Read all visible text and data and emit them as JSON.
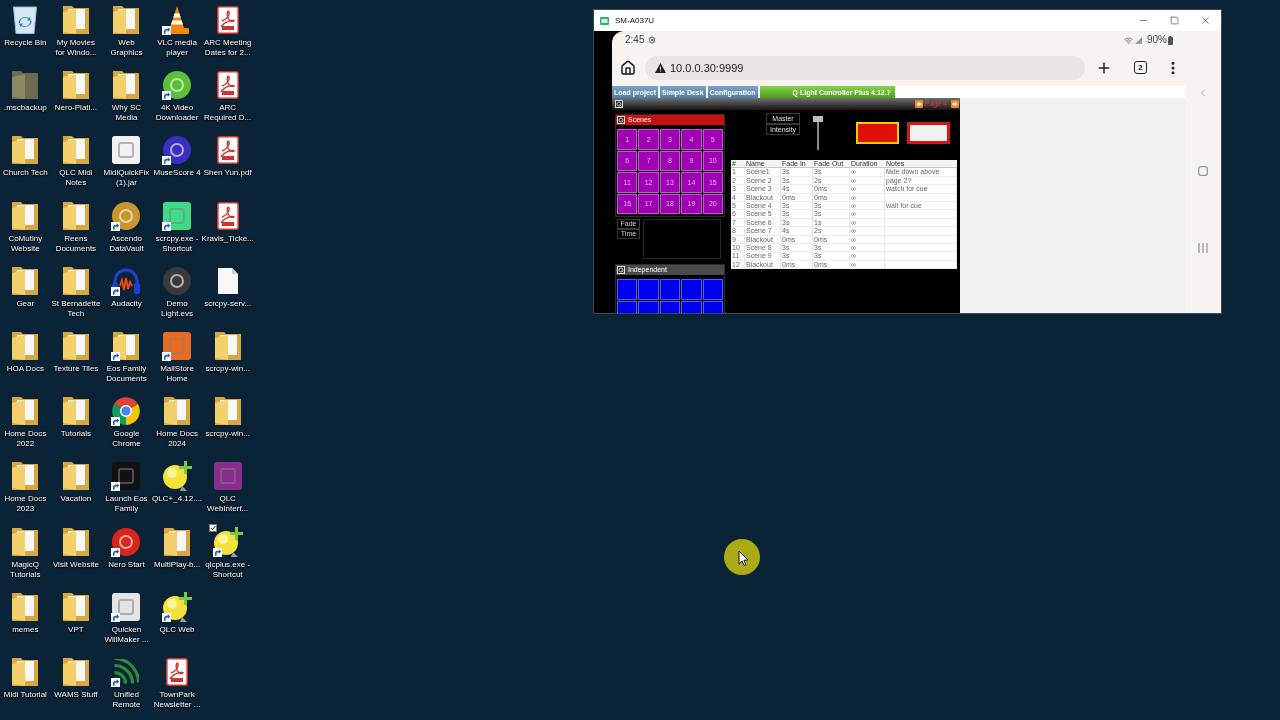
{
  "desktop": {
    "icons": [
      {
        "label": "Recycle Bin",
        "kind": "recycle-bin",
        "shortcut": false,
        "checked": false
      },
      {
        "label": ".mscbackup",
        "kind": "hidden-folder",
        "shortcut": false,
        "checked": false
      },
      {
        "label": "Church Tech",
        "kind": "folder",
        "shortcut": false,
        "checked": false
      },
      {
        "label": "CoMutiny Website",
        "kind": "folder",
        "shortcut": false,
        "checked": false
      },
      {
        "label": "Gear",
        "kind": "folder",
        "shortcut": false,
        "checked": false
      },
      {
        "label": "HOA Docs",
        "kind": "folder",
        "shortcut": false,
        "checked": false
      },
      {
        "label": "Home Docs 2022",
        "kind": "folder",
        "shortcut": false,
        "checked": false
      },
      {
        "label": "Home Docs 2023",
        "kind": "folder",
        "shortcut": false,
        "checked": false
      },
      {
        "label": "MagicQ Tutorials",
        "kind": "folder",
        "shortcut": false,
        "checked": false
      },
      {
        "label": "memes",
        "kind": "folder",
        "shortcut": false,
        "checked": false
      },
      {
        "label": "Midi Tutorial",
        "kind": "folder",
        "shortcut": false,
        "checked": false
      },
      {
        "label": "My Movies for Windo...",
        "kind": "folder",
        "shortcut": false,
        "checked": false
      },
      {
        "label": "Nero-Plati...",
        "kind": "folder",
        "shortcut": false,
        "checked": false
      },
      {
        "label": "QLC Midi Notes",
        "kind": "folder",
        "shortcut": false,
        "checked": false
      },
      {
        "label": "Reens Documents",
        "kind": "folder",
        "shortcut": false,
        "checked": false
      },
      {
        "label": "St Bernadette Tech",
        "kind": "folder",
        "shortcut": false,
        "checked": false
      },
      {
        "label": "Texture Tiles",
        "kind": "folder",
        "shortcut": false,
        "checked": false
      },
      {
        "label": "Tutorials",
        "kind": "folder",
        "shortcut": false,
        "checked": false
      },
      {
        "label": "Vacation",
        "kind": "folder",
        "shortcut": false,
        "checked": false
      },
      {
        "label": "Visit Website",
        "kind": "folder",
        "shortcut": false,
        "checked": false
      },
      {
        "label": "VPT",
        "kind": "folder",
        "shortcut": false,
        "checked": false
      },
      {
        "label": "WAMS Stuff",
        "kind": "folder",
        "shortcut": false,
        "checked": false
      },
      {
        "label": "Web Graphics",
        "kind": "folder",
        "shortcut": false,
        "checked": false
      },
      {
        "label": "Why SC Media",
        "kind": "folder",
        "shortcut": false,
        "checked": false
      },
      {
        "label": "MidiQuickFix (1).jar",
        "kind": "tile",
        "color": "#f2f2f2",
        "shortcut": false,
        "checked": false
      },
      {
        "label": "Ascendo DataVault",
        "kind": "disc",
        "color": "#c8962e",
        "shortcut": true,
        "checked": false
      },
      {
        "label": "Audacity",
        "kind": "headphones",
        "shortcut": true,
        "checked": false
      },
      {
        "label": "Eos Family Documents",
        "kind": "folder",
        "shortcut": true,
        "checked": false
      },
      {
        "label": "Google Chrome",
        "kind": "pinwheel",
        "shortcut": true,
        "checked": false
      },
      {
        "label": "Launch Eos Family",
        "kind": "tile",
        "color": "#111111",
        "shortcut": true,
        "checked": false
      },
      {
        "label": "Nero Start",
        "kind": "disc",
        "color": "#d8261c",
        "shortcut": true,
        "checked": false
      },
      {
        "label": "Quicken WillMaker ...",
        "kind": "tile",
        "color": "#e4e4e4",
        "shortcut": true,
        "checked": false
      },
      {
        "label": "Unified Remote",
        "kind": "waves",
        "shortcut": true,
        "checked": false
      },
      {
        "label": "VLC media player",
        "kind": "cone",
        "shortcut": true,
        "checked": false
      },
      {
        "label": "4K Video Downloader",
        "kind": "disc",
        "color": "#5bbf3a",
        "shortcut": true,
        "checked": false
      },
      {
        "label": "MuseScore 4",
        "kind": "disc",
        "color": "#3a2fc2",
        "shortcut": true,
        "checked": false
      },
      {
        "label": "scrcpy.exe - Shortcut",
        "kind": "tile",
        "color": "#3ddc84",
        "shortcut": true,
        "checked": false
      },
      {
        "label": "Demo Light.evs",
        "kind": "disc",
        "color": "#3a3a3a",
        "shortcut": false,
        "checked": false
      },
      {
        "label": "MailStore Home",
        "kind": "tile",
        "color": "#ee6a1f",
        "shortcut": true,
        "checked": false
      },
      {
        "label": "Home Docs 2024",
        "kind": "folder",
        "shortcut": false,
        "checked": false
      },
      {
        "label": "QLC+_4.12....",
        "kind": "bulb",
        "shortcut": false,
        "checked": false
      },
      {
        "label": "MultiPlay-b...",
        "kind": "folder",
        "shortcut": false,
        "checked": false
      },
      {
        "label": "QLC Web",
        "kind": "bulb",
        "shortcut": true,
        "checked": false
      },
      {
        "label": "TownPark Newsletter ...",
        "kind": "pdf",
        "shortcut": false,
        "checked": false
      },
      {
        "label": "ARC Meeting Dates for 2...",
        "kind": "pdf",
        "shortcut": false,
        "checked": false
      },
      {
        "label": "ARC Required D...",
        "kind": "pdf",
        "shortcut": false,
        "checked": false
      },
      {
        "label": "Shen Yun.pdf",
        "kind": "pdf",
        "shortcut": false,
        "checked": false
      },
      {
        "label": "Kravis_Ticke...",
        "kind": "pdf",
        "shortcut": false,
        "checked": false
      },
      {
        "label": "scrcpy-serv...",
        "kind": "file",
        "shortcut": false,
        "checked": false
      },
      {
        "label": "scrcpy-win...",
        "kind": "folder",
        "shortcut": false,
        "checked": false
      },
      {
        "label": "scrcpy-win...",
        "kind": "folder",
        "shortcut": false,
        "checked": false
      },
      {
        "label": "QLC WebInterf...",
        "kind": "tile",
        "color": "#8a2b8e",
        "shortcut": false,
        "checked": false
      },
      {
        "label": "qlcplus.exe - Shortcut",
        "kind": "bulb",
        "shortcut": true,
        "checked": true
      }
    ]
  },
  "window": {
    "title": "SM-A037U"
  },
  "phone": {
    "status_bar": {
      "time": "2:45",
      "battery": "90%"
    },
    "browser": {
      "url": "10.0.0.30:9999",
      "tab_count": "2"
    },
    "qlc": {
      "menu": [
        "Load project",
        "Simple Desk",
        "Configuration"
      ],
      "title": "Q Light Controller Plus 4.12.7",
      "page": "Page 4",
      "frames": [
        {
          "title": "Scenes",
          "color": "#c81010",
          "buttons": [
            {
              "label": "1",
              "color": "#a000b4",
              "active": false
            },
            {
              "label": "2",
              "color": "#a000b4",
              "active": false
            },
            {
              "label": "3",
              "color": "#a000b4",
              "active": false
            },
            {
              "label": "4",
              "color": "#a000b4",
              "active": false
            },
            {
              "label": "5",
              "color": "#a000b4",
              "active": false
            },
            {
              "label": "6",
              "color": "#a000b4",
              "active": false
            },
            {
              "label": "7",
              "color": "#a000b4",
              "active": false
            },
            {
              "label": "8",
              "color": "#a000b4",
              "active": false
            },
            {
              "label": "9",
              "color": "#a000b4",
              "active": false
            },
            {
              "label": "10",
              "color": "#a000b4",
              "active": false
            },
            {
              "label": "11",
              "color": "#a000b4",
              "active": false
            },
            {
              "label": "12",
              "color": "#a000b4",
              "active": false
            },
            {
              "label": "13",
              "color": "#a000b4",
              "active": false
            },
            {
              "label": "14",
              "color": "#a000b4",
              "active": false
            },
            {
              "label": "15",
              "color": "#a000b4",
              "active": false
            },
            {
              "label": "16",
              "color": "#a000b4",
              "active": false
            },
            {
              "label": "17",
              "color": "#a000b4",
              "active": false
            },
            {
              "label": "18",
              "color": "#a000b4",
              "active": false
            },
            {
              "label": "19",
              "color": "#a000b4",
              "active": false
            },
            {
              "label": "20",
              "color": "#a000b4",
              "active": false
            }
          ]
        },
        {
          "title": "Independent",
          "color": "#4a4a4a",
          "buttons": [
            {
              "color": "#0000f0",
              "active": false
            },
            {
              "color": "#0000f0",
              "active": false
            },
            {
              "color": "#0000f0",
              "active": false
            },
            {
              "color": "#0000f0",
              "active": false
            },
            {
              "color": "#0000f0",
              "active": false
            },
            {
              "color": "#0000f0",
              "active": false
            },
            {
              "color": "#0000f0",
              "active": false
            },
            {
              "color": "#0000f0",
              "active": false
            },
            {
              "color": "#0000f0",
              "active": false
            },
            {
              "color": "#0000f0",
              "active": false
            }
          ]
        }
      ],
      "speed_dial": {
        "labels": [
          "Fade",
          "Time"
        ]
      },
      "slider": {
        "labels": [
          "Master",
          "Intensity"
        ],
        "level": 1
      },
      "buttons": [
        {
          "color": "#e01000",
          "selected": true
        },
        {
          "color": "#f0f0f0",
          "selected": false
        }
      ],
      "cue_list": {
        "columns": [
          "#",
          "Name",
          "Fade In",
          "Fade Out",
          "Duration",
          "Notes"
        ],
        "rows": [
          {
            "number": "1",
            "name": "Scene1",
            "fade_in": "3s",
            "fade_out": "3s",
            "duration": "∞",
            "notes": "fade down above"
          },
          {
            "number": "2",
            "name": "Scene 2",
            "fade_in": "3s",
            "fade_out": "2s",
            "duration": "∞",
            "notes": "page 2?"
          },
          {
            "number": "3",
            "name": "Scene 3",
            "fade_in": "4s",
            "fade_out": "0ms",
            "duration": "∞",
            "notes": "watch for cue"
          },
          {
            "number": "4",
            "name": "Blackout",
            "fade_in": "0ms",
            "fade_out": "0ms",
            "duration": "∞"
          },
          {
            "number": "5",
            "name": "Scene 4",
            "fade_in": "3s",
            "fade_out": "3s",
            "duration": "∞",
            "notes": "wait for cue"
          },
          {
            "number": "6",
            "name": "Scene 5",
            "fade_in": "3s",
            "fade_out": "3s",
            "duration": "∞"
          },
          {
            "number": "7",
            "name": "Scene 6",
            "fade_in": "3s",
            "fade_out": "1s",
            "duration": "∞"
          },
          {
            "number": "8",
            "name": "Scene 7",
            "fade_in": "4s",
            "fade_out": "2s",
            "duration": "∞"
          },
          {
            "number": "9",
            "name": "Blackout",
            "fade_in": "0ms",
            "fade_out": "0ms",
            "duration": "∞"
          },
          {
            "number": "10",
            "name": "Scene 8",
            "fade_in": "3s",
            "fade_out": "3s",
            "duration": "∞"
          },
          {
            "number": "11",
            "name": "Scene 9",
            "fade_in": "3s",
            "fade_out": "3s",
            "duration": "∞"
          },
          {
            "number": "12",
            "name": "Blackout",
            "fade_in": "0ms",
            "fade_out": "0ms",
            "duration": "∞"
          }
        ]
      }
    }
  }
}
